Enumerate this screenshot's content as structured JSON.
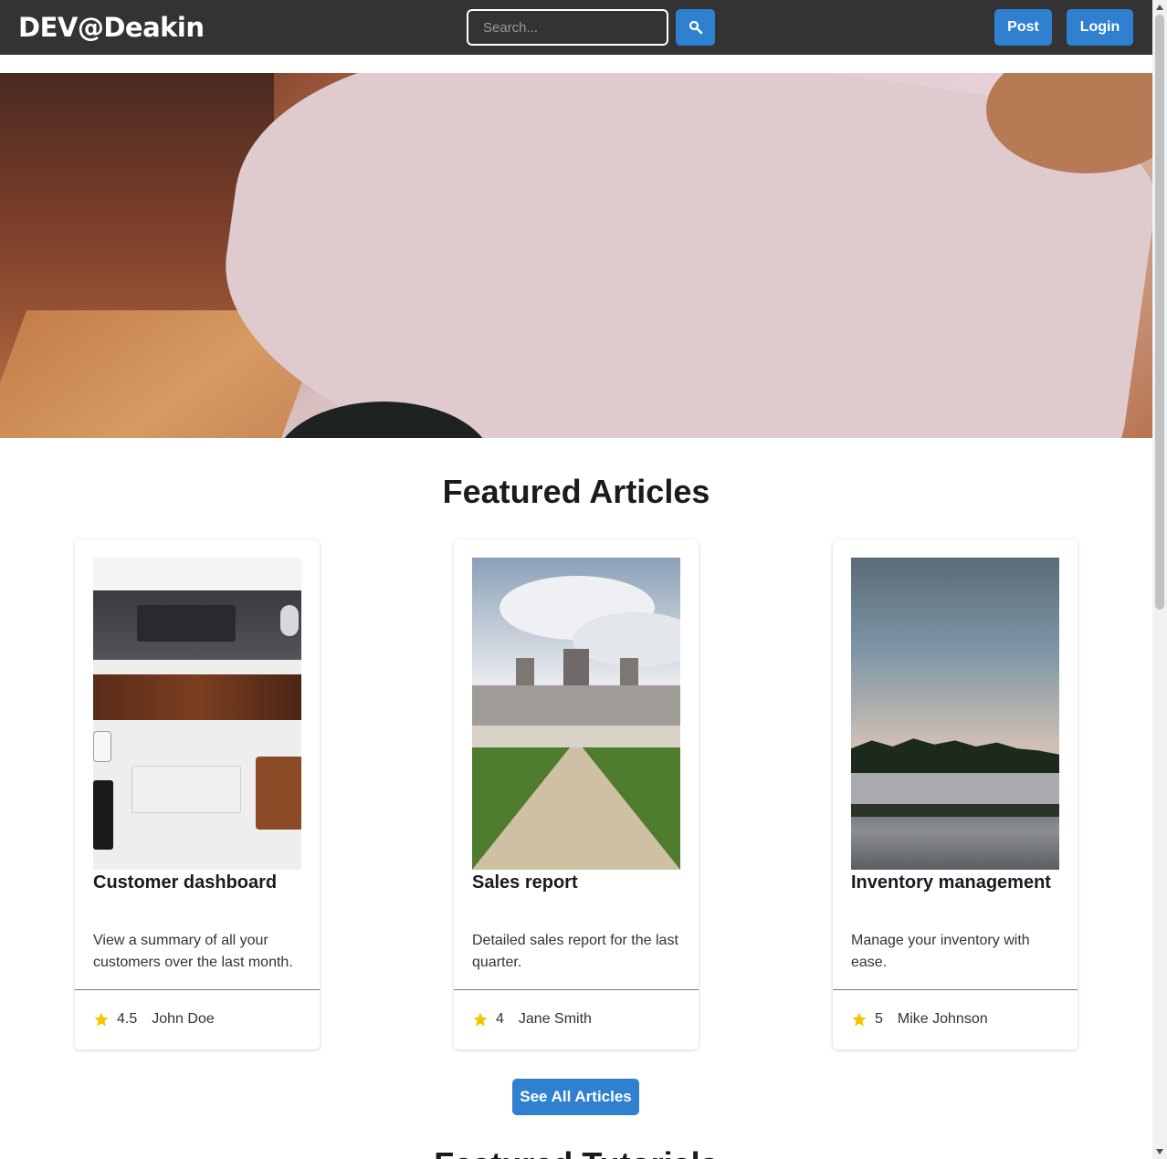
{
  "header": {
    "brand": "DEV@Deakin",
    "search_placeholder": "Search...",
    "search_icon": "search-icon",
    "post_label": "Post",
    "login_label": "Login"
  },
  "featured": {
    "title": "Featured Articles",
    "articles": [
      {
        "title": "Customer dashboard",
        "description": "View a summary of all your customers over the last month.",
        "rating": "4.5",
        "author": "John Doe"
      },
      {
        "title": "Sales report",
        "description": "Detailed sales report for the last quarter.",
        "rating": "4",
        "author": "Jane Smith"
      },
      {
        "title": "Inventory management",
        "description": "Manage your inventory with ease.",
        "rating": "5",
        "author": "Mike Johnson"
      }
    ],
    "see_all_label": "See All Articles"
  },
  "tutorials": {
    "title": "Featured Tutorials"
  },
  "colors": {
    "navbar": "#333333",
    "accent": "#3080d0",
    "star": "#f5c400"
  }
}
